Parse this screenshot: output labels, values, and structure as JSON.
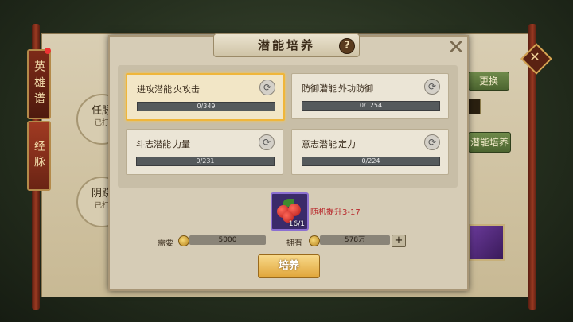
{
  "background": {
    "side_tabs": [
      {
        "label": "英雄谱",
        "active": false
      },
      {
        "label": "经脉",
        "active": true
      }
    ],
    "meridian_nodes": [
      {
        "label": "任脉",
        "status": "已打"
      },
      {
        "label": "阴跷",
        "status": "已打"
      }
    ],
    "buttons": {
      "replace": "更换",
      "potential_train": "潜能培养"
    }
  },
  "modal": {
    "title": "潜能培养",
    "help": "?",
    "close": "✕",
    "potentials": [
      {
        "name": "进攻潜能",
        "skill": "火攻击",
        "progress": "0/349",
        "selected": true
      },
      {
        "name": "防御潜能",
        "skill": "外功防御",
        "progress": "0/1254",
        "selected": false
      },
      {
        "name": "斗志潜能",
        "skill": "力量",
        "progress": "0/231",
        "selected": false
      },
      {
        "name": "意志潜能",
        "skill": "定力",
        "progress": "0/224",
        "selected": false
      }
    ],
    "item": {
      "count": "16/1",
      "icon": "red-berry-icon",
      "bonus": "随机提升3-17"
    },
    "cost": {
      "label": "需要",
      "value": "5000"
    },
    "owned": {
      "label": "拥有",
      "value": "578万"
    },
    "plus": "+",
    "train_button": "培养"
  }
}
